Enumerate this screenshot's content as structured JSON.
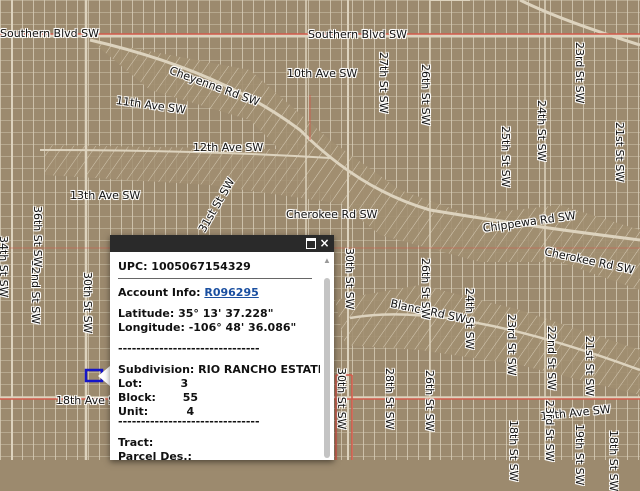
{
  "map": {
    "colors": {
      "ground": "#9c8a6e",
      "road": "#d9d0bd",
      "highlight": "#d25a4a",
      "parcel": "#e3dccb",
      "selected": "#1515c8"
    },
    "labels": {
      "southern_blvd_left": "Southern Blvd SW",
      "southern_blvd_right": "Southern Blvd SW",
      "cheyenne_rd": "Cheyenne Rd SW",
      "tenth_ave": "10th Ave SW",
      "eleventh_ave": "11th Ave SW",
      "twelfth_ave": "12th Ave SW",
      "thirteenth_ave": "13th Ave SW",
      "cherokee_rd": "Cherokee Rd SW",
      "chippewa_rd": "Chippewa Rd SW",
      "cherokee_rd_right": "Cherokee Rd SW",
      "blanco_rd": "Blanco Rd SW",
      "eighteenth_ave_left": "18th Ave SW",
      "eighteenth_ave_right": "18th Ave SW",
      "thirtyfirst_st": "31st St SW",
      "thirtysecond_st": "32nd St SW",
      "thirtieth_st": "30th St SW",
      "thirtieth_st_left": "30th St SW",
      "thirtieth_st_bottom": "30th St SW",
      "twentyseventh_st_left": "27th St SW",
      "twentysixth_st_left": "26th St SW",
      "twentyfifth_st": "25th St SW",
      "twentyfourth_st": "24th St SW",
      "twentysixth_st": "26th St SW",
      "twentyfifth_st_b": "25th St SW",
      "twentythird_st": "23rd St SW",
      "twentyfourth_st_b": "24th St SW",
      "twentysecond_st": "22nd St SW",
      "twentyfirst_st": "21st St SW",
      "twentythird_st_top": "23rd St SW",
      "twentyfirst_st_top": "21st St SW",
      "twentieth_st": "20th St SW",
      "thirtyfourth_st": "34th St SW",
      "thirtysixth_st": "36th St SW",
      "thirtysecond_st_b": "32nd St SW",
      "nineteenth_st": "19th St SW",
      "twentyeighth_st": "28th St SW",
      "twentythird_st_b": "23rd St SW",
      "twentysecond_st_b": "22nd St SW",
      "eighteenth_st": "18th St SW",
      "eighteenth_st_b": "18th St SW"
    }
  },
  "popup": {
    "upc_line": "UPC: 1005067154329",
    "account_label": "Account Info: ",
    "account_link": "R096295",
    "latitude": "Latitude: 35° 13' 37.228\"",
    "longitude": "Longitude: -106° 48' 36.086\"",
    "dashes_1": "-------------------------------",
    "subdivision": "Subdivision: RIO RANCHO ESTATES",
    "lot": "Lot:          3",
    "block": "Block:       55",
    "unit": "Unit:          4",
    "dashes_2": "-------------------------------",
    "tract": "Tract:",
    "parcel_des": "Parcel Des.:",
    "close_icon": "×",
    "maximize_icon": "maximize-icon"
  }
}
